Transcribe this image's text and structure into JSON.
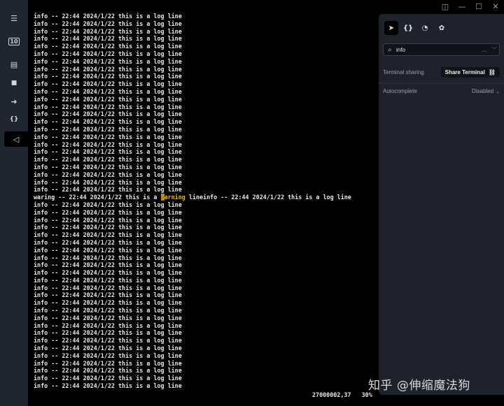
{
  "window_controls": {
    "layout_icon": "layout-icon",
    "minimize": "minimize-icon",
    "maximize": "maximize-icon",
    "close": "close-icon"
  },
  "sidebar": {
    "items": [
      {
        "name": "menu-icon",
        "glyph": "☰"
      },
      {
        "name": "tab-count-icon",
        "glyph": "10"
      },
      {
        "name": "server-icon",
        "glyph": "▤"
      },
      {
        "name": "folder-icon",
        "glyph": "■"
      },
      {
        "name": "forward-icon",
        "glyph": "➜"
      },
      {
        "name": "snippets-icon",
        "glyph": "{}"
      },
      {
        "name": "terminal-icon",
        "glyph": "◁"
      }
    ],
    "active_index": 6
  },
  "terminal": {
    "info_line": "info -- 22:44 2024/1/22 this is a log line",
    "lines_before": 24,
    "lines_after": 25,
    "warn_line": {
      "prefix": "waring -- 22:44 2024/1/22 this is a ",
      "cursor": " ",
      "match": "arning",
      "suffix": " lineinfo -- 22:44 2024/1/22 this is a log line"
    }
  },
  "status": {
    "position": "27000002,37",
    "percent": "30%"
  },
  "panel": {
    "tabs": [
      {
        "name": "navigate-icon",
        "glyph": "➤"
      },
      {
        "name": "code-icon",
        "glyph": "{}"
      },
      {
        "name": "history-icon",
        "glyph": "◔"
      },
      {
        "name": "palette-icon",
        "glyph": "✿"
      }
    ],
    "search": {
      "value": "info",
      "placeholder": ""
    },
    "terminal_sharing": {
      "label": "Terminal sharing",
      "button": "Share Terminal"
    },
    "autocomplete": {
      "label": "Autocomplete",
      "value": "Disabled"
    }
  },
  "watermark": "知乎 @伸缩魔法狗"
}
